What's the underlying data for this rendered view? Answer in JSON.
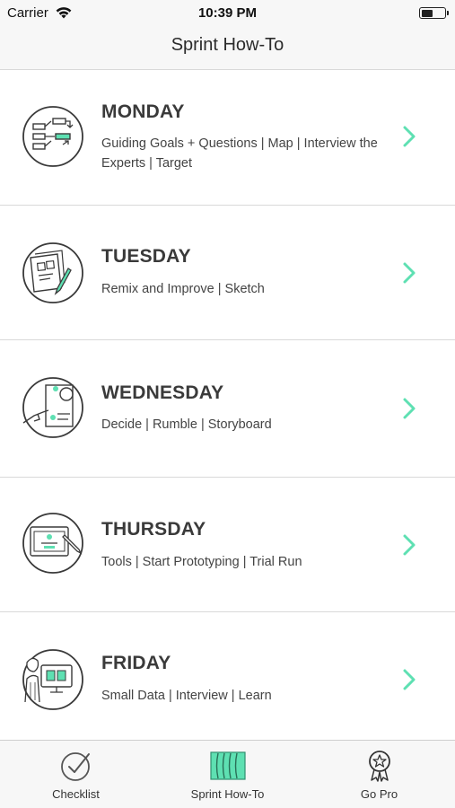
{
  "status_bar": {
    "carrier": "Carrier",
    "time": "10:39 PM",
    "battery_level": 0.5
  },
  "nav": {
    "title": "Sprint How-To"
  },
  "days": [
    {
      "title": "MONDAY",
      "description": "Guiding Goals + Questions | Map | Interview the Experts | Target",
      "icon": "map-diagram-icon"
    },
    {
      "title": "TUESDAY",
      "description": "Remix and Improve | Sketch",
      "icon": "sketch-paper-icon"
    },
    {
      "title": "WEDNESDAY",
      "description": "Decide | Rumble | Storyboard",
      "icon": "storyboard-icon"
    },
    {
      "title": "THURSDAY",
      "description": "Tools | Start Prototyping | Trial Run",
      "icon": "prototype-screen-icon"
    },
    {
      "title": "FRIDAY",
      "description": "Small Data | Interview | Learn",
      "icon": "user-test-icon"
    }
  ],
  "tabs": [
    {
      "label": "Checklist",
      "icon": "checklist-icon",
      "selected": false
    },
    {
      "label": "Sprint How-To",
      "icon": "sprint-howto-icon",
      "selected": true
    },
    {
      "label": "Go Pro",
      "icon": "award-badge-icon",
      "selected": false
    }
  ],
  "colors": {
    "accent": "#5ee0b2",
    "text": "#3a3a3a",
    "bar_background": "#f7f7f7",
    "divider": "#d9d9d9"
  }
}
